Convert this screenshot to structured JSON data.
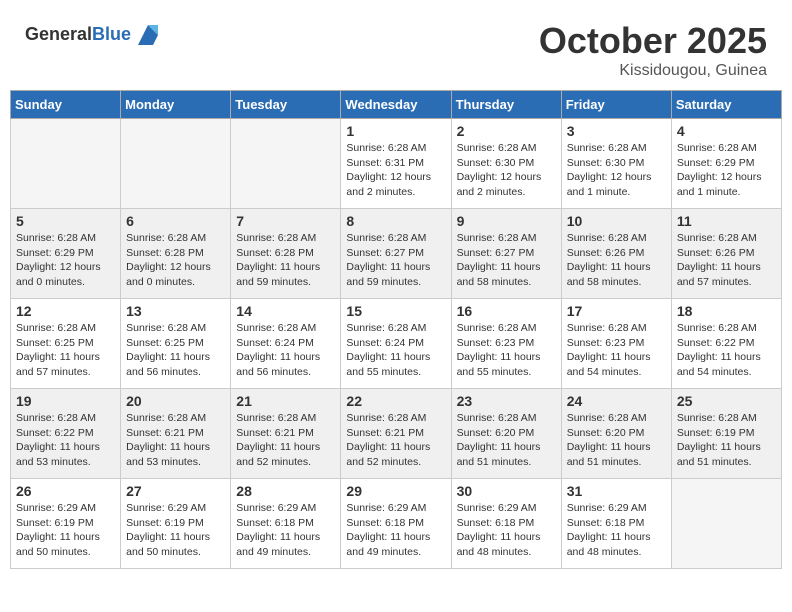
{
  "header": {
    "logo_general": "General",
    "logo_blue": "Blue",
    "month": "October 2025",
    "location": "Kissidougou, Guinea"
  },
  "weekdays": [
    "Sunday",
    "Monday",
    "Tuesday",
    "Wednesday",
    "Thursday",
    "Friday",
    "Saturday"
  ],
  "weeks": [
    [
      {
        "day": "",
        "sunrise": "",
        "sunset": "",
        "daylight": "",
        "empty": true
      },
      {
        "day": "",
        "sunrise": "",
        "sunset": "",
        "daylight": "",
        "empty": true
      },
      {
        "day": "",
        "sunrise": "",
        "sunset": "",
        "daylight": "",
        "empty": true
      },
      {
        "day": "1",
        "sunrise": "Sunrise: 6:28 AM",
        "sunset": "Sunset: 6:31 PM",
        "daylight": "Daylight: 12 hours and 2 minutes.",
        "empty": false
      },
      {
        "day": "2",
        "sunrise": "Sunrise: 6:28 AM",
        "sunset": "Sunset: 6:30 PM",
        "daylight": "Daylight: 12 hours and 2 minutes.",
        "empty": false
      },
      {
        "day": "3",
        "sunrise": "Sunrise: 6:28 AM",
        "sunset": "Sunset: 6:30 PM",
        "daylight": "Daylight: 12 hours and 1 minute.",
        "empty": false
      },
      {
        "day": "4",
        "sunrise": "Sunrise: 6:28 AM",
        "sunset": "Sunset: 6:29 PM",
        "daylight": "Daylight: 12 hours and 1 minute.",
        "empty": false
      }
    ],
    [
      {
        "day": "5",
        "sunrise": "Sunrise: 6:28 AM",
        "sunset": "Sunset: 6:29 PM",
        "daylight": "Daylight: 12 hours and 0 minutes.",
        "empty": false
      },
      {
        "day": "6",
        "sunrise": "Sunrise: 6:28 AM",
        "sunset": "Sunset: 6:28 PM",
        "daylight": "Daylight: 12 hours and 0 minutes.",
        "empty": false
      },
      {
        "day": "7",
        "sunrise": "Sunrise: 6:28 AM",
        "sunset": "Sunset: 6:28 PM",
        "daylight": "Daylight: 11 hours and 59 minutes.",
        "empty": false
      },
      {
        "day": "8",
        "sunrise": "Sunrise: 6:28 AM",
        "sunset": "Sunset: 6:27 PM",
        "daylight": "Daylight: 11 hours and 59 minutes.",
        "empty": false
      },
      {
        "day": "9",
        "sunrise": "Sunrise: 6:28 AM",
        "sunset": "Sunset: 6:27 PM",
        "daylight": "Daylight: 11 hours and 58 minutes.",
        "empty": false
      },
      {
        "day": "10",
        "sunrise": "Sunrise: 6:28 AM",
        "sunset": "Sunset: 6:26 PM",
        "daylight": "Daylight: 11 hours and 58 minutes.",
        "empty": false
      },
      {
        "day": "11",
        "sunrise": "Sunrise: 6:28 AM",
        "sunset": "Sunset: 6:26 PM",
        "daylight": "Daylight: 11 hours and 57 minutes.",
        "empty": false
      }
    ],
    [
      {
        "day": "12",
        "sunrise": "Sunrise: 6:28 AM",
        "sunset": "Sunset: 6:25 PM",
        "daylight": "Daylight: 11 hours and 57 minutes.",
        "empty": false
      },
      {
        "day": "13",
        "sunrise": "Sunrise: 6:28 AM",
        "sunset": "Sunset: 6:25 PM",
        "daylight": "Daylight: 11 hours and 56 minutes.",
        "empty": false
      },
      {
        "day": "14",
        "sunrise": "Sunrise: 6:28 AM",
        "sunset": "Sunset: 6:24 PM",
        "daylight": "Daylight: 11 hours and 56 minutes.",
        "empty": false
      },
      {
        "day": "15",
        "sunrise": "Sunrise: 6:28 AM",
        "sunset": "Sunset: 6:24 PM",
        "daylight": "Daylight: 11 hours and 55 minutes.",
        "empty": false
      },
      {
        "day": "16",
        "sunrise": "Sunrise: 6:28 AM",
        "sunset": "Sunset: 6:23 PM",
        "daylight": "Daylight: 11 hours and 55 minutes.",
        "empty": false
      },
      {
        "day": "17",
        "sunrise": "Sunrise: 6:28 AM",
        "sunset": "Sunset: 6:23 PM",
        "daylight": "Daylight: 11 hours and 54 minutes.",
        "empty": false
      },
      {
        "day": "18",
        "sunrise": "Sunrise: 6:28 AM",
        "sunset": "Sunset: 6:22 PM",
        "daylight": "Daylight: 11 hours and 54 minutes.",
        "empty": false
      }
    ],
    [
      {
        "day": "19",
        "sunrise": "Sunrise: 6:28 AM",
        "sunset": "Sunset: 6:22 PM",
        "daylight": "Daylight: 11 hours and 53 minutes.",
        "empty": false
      },
      {
        "day": "20",
        "sunrise": "Sunrise: 6:28 AM",
        "sunset": "Sunset: 6:21 PM",
        "daylight": "Daylight: 11 hours and 53 minutes.",
        "empty": false
      },
      {
        "day": "21",
        "sunrise": "Sunrise: 6:28 AM",
        "sunset": "Sunset: 6:21 PM",
        "daylight": "Daylight: 11 hours and 52 minutes.",
        "empty": false
      },
      {
        "day": "22",
        "sunrise": "Sunrise: 6:28 AM",
        "sunset": "Sunset: 6:21 PM",
        "daylight": "Daylight: 11 hours and 52 minutes.",
        "empty": false
      },
      {
        "day": "23",
        "sunrise": "Sunrise: 6:28 AM",
        "sunset": "Sunset: 6:20 PM",
        "daylight": "Daylight: 11 hours and 51 minutes.",
        "empty": false
      },
      {
        "day": "24",
        "sunrise": "Sunrise: 6:28 AM",
        "sunset": "Sunset: 6:20 PM",
        "daylight": "Daylight: 11 hours and 51 minutes.",
        "empty": false
      },
      {
        "day": "25",
        "sunrise": "Sunrise: 6:28 AM",
        "sunset": "Sunset: 6:19 PM",
        "daylight": "Daylight: 11 hours and 51 minutes.",
        "empty": false
      }
    ],
    [
      {
        "day": "26",
        "sunrise": "Sunrise: 6:29 AM",
        "sunset": "Sunset: 6:19 PM",
        "daylight": "Daylight: 11 hours and 50 minutes.",
        "empty": false
      },
      {
        "day": "27",
        "sunrise": "Sunrise: 6:29 AM",
        "sunset": "Sunset: 6:19 PM",
        "daylight": "Daylight: 11 hours and 50 minutes.",
        "empty": false
      },
      {
        "day": "28",
        "sunrise": "Sunrise: 6:29 AM",
        "sunset": "Sunset: 6:18 PM",
        "daylight": "Daylight: 11 hours and 49 minutes.",
        "empty": false
      },
      {
        "day": "29",
        "sunrise": "Sunrise: 6:29 AM",
        "sunset": "Sunset: 6:18 PM",
        "daylight": "Daylight: 11 hours and 49 minutes.",
        "empty": false
      },
      {
        "day": "30",
        "sunrise": "Sunrise: 6:29 AM",
        "sunset": "Sunset: 6:18 PM",
        "daylight": "Daylight: 11 hours and 48 minutes.",
        "empty": false
      },
      {
        "day": "31",
        "sunrise": "Sunrise: 6:29 AM",
        "sunset": "Sunset: 6:18 PM",
        "daylight": "Daylight: 11 hours and 48 minutes.",
        "empty": false
      },
      {
        "day": "",
        "sunrise": "",
        "sunset": "",
        "daylight": "",
        "empty": true
      }
    ]
  ]
}
